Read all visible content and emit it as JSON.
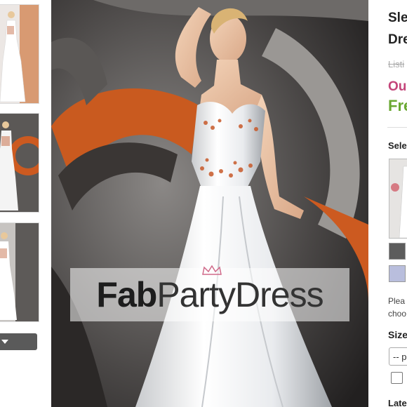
{
  "brand": {
    "watermark_part1": "Fab",
    "watermark_part2": "Party",
    "watermark_part3": "Dress"
  },
  "product": {
    "title_line1": "Sle",
    "title_line2": "Dre",
    "list_price_label": "Listi",
    "our_price_label": "Our",
    "free_label": "Fre"
  },
  "options": {
    "select_label": "Sele",
    "note_line1": "Plea",
    "note_line2": "choo",
    "size_label": "Size",
    "size_select_value": "-- p",
    "latest_label": "Late"
  },
  "colors": {
    "our_price": "#c4457a",
    "free": "#6aa832",
    "swatch1": "#5c5c5c",
    "swatch2": "#b9bedd"
  }
}
